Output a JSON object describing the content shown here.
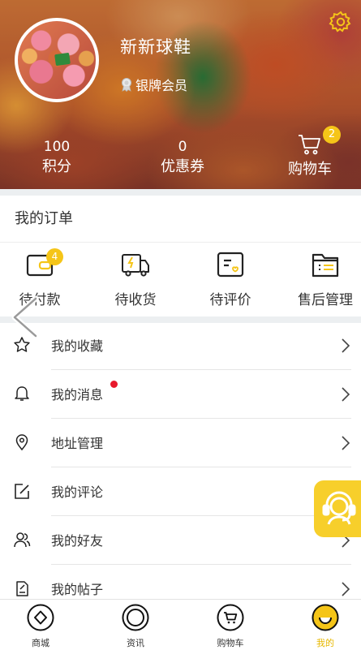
{
  "profile": {
    "username": "新新球鞋",
    "member_level": "银牌会员"
  },
  "stats": {
    "points_value": "100",
    "points_label": "积分",
    "coupons_value": "0",
    "coupons_label": "优惠券",
    "cart_label": "购物车",
    "cart_count": "2"
  },
  "orders": {
    "title": "我的订单",
    "items": [
      {
        "label": "待付款",
        "badge": "4",
        "icon": "wallet-icon"
      },
      {
        "label": "待收货",
        "icon": "delivery-truck-icon"
      },
      {
        "label": "待评价",
        "icon": "review-icon"
      },
      {
        "label": "售后管理",
        "icon": "after-sales-folder-icon"
      }
    ]
  },
  "menu": [
    {
      "label": "我的收藏",
      "icon": "star-icon"
    },
    {
      "label": "我的消息",
      "icon": "bell-icon",
      "has_unread_dot": true
    },
    {
      "label": "地址管理",
      "icon": "location-pin-icon"
    },
    {
      "label": "我的评论",
      "icon": "edit-icon"
    },
    {
      "label": "我的好友",
      "icon": "friends-icon"
    },
    {
      "label": "我的帖子",
      "icon": "post-icon"
    }
  ],
  "bottom_nav": [
    {
      "label": "商城",
      "icon": "diamond-shop-icon"
    },
    {
      "label": "资讯",
      "icon": "news-circle-icon"
    },
    {
      "label": "购物车",
      "icon": "cart-icon"
    },
    {
      "label": "我的",
      "icon": "profile-face-icon",
      "active": true
    }
  ],
  "colors": {
    "accent": "#f5c518",
    "active_nav": "#e7b800",
    "unread_dot": "#e8192c",
    "divider": "#eceff1"
  }
}
